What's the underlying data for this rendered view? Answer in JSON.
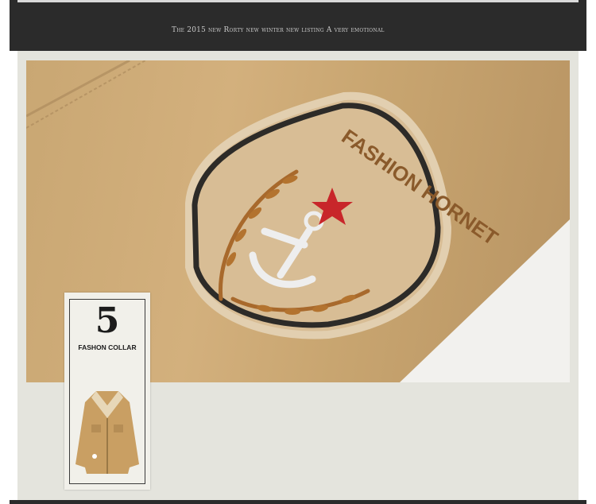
{
  "banner": {
    "caption": "The 2015 new Rorty new winter new listing  A very emotional"
  },
  "photo": {
    "description_icon": "anchor-badge-icon",
    "badge_text": "FASHION HORNET"
  },
  "feature_card": {
    "number": "5",
    "label": "FASHON COLLAR",
    "image_icon": "jacket-icon"
  },
  "colors": {
    "banner_bg": "#2b2b2b",
    "panel_bg": "#e4e4dd",
    "fabric": "#c9a773",
    "star": "#c8262a"
  }
}
